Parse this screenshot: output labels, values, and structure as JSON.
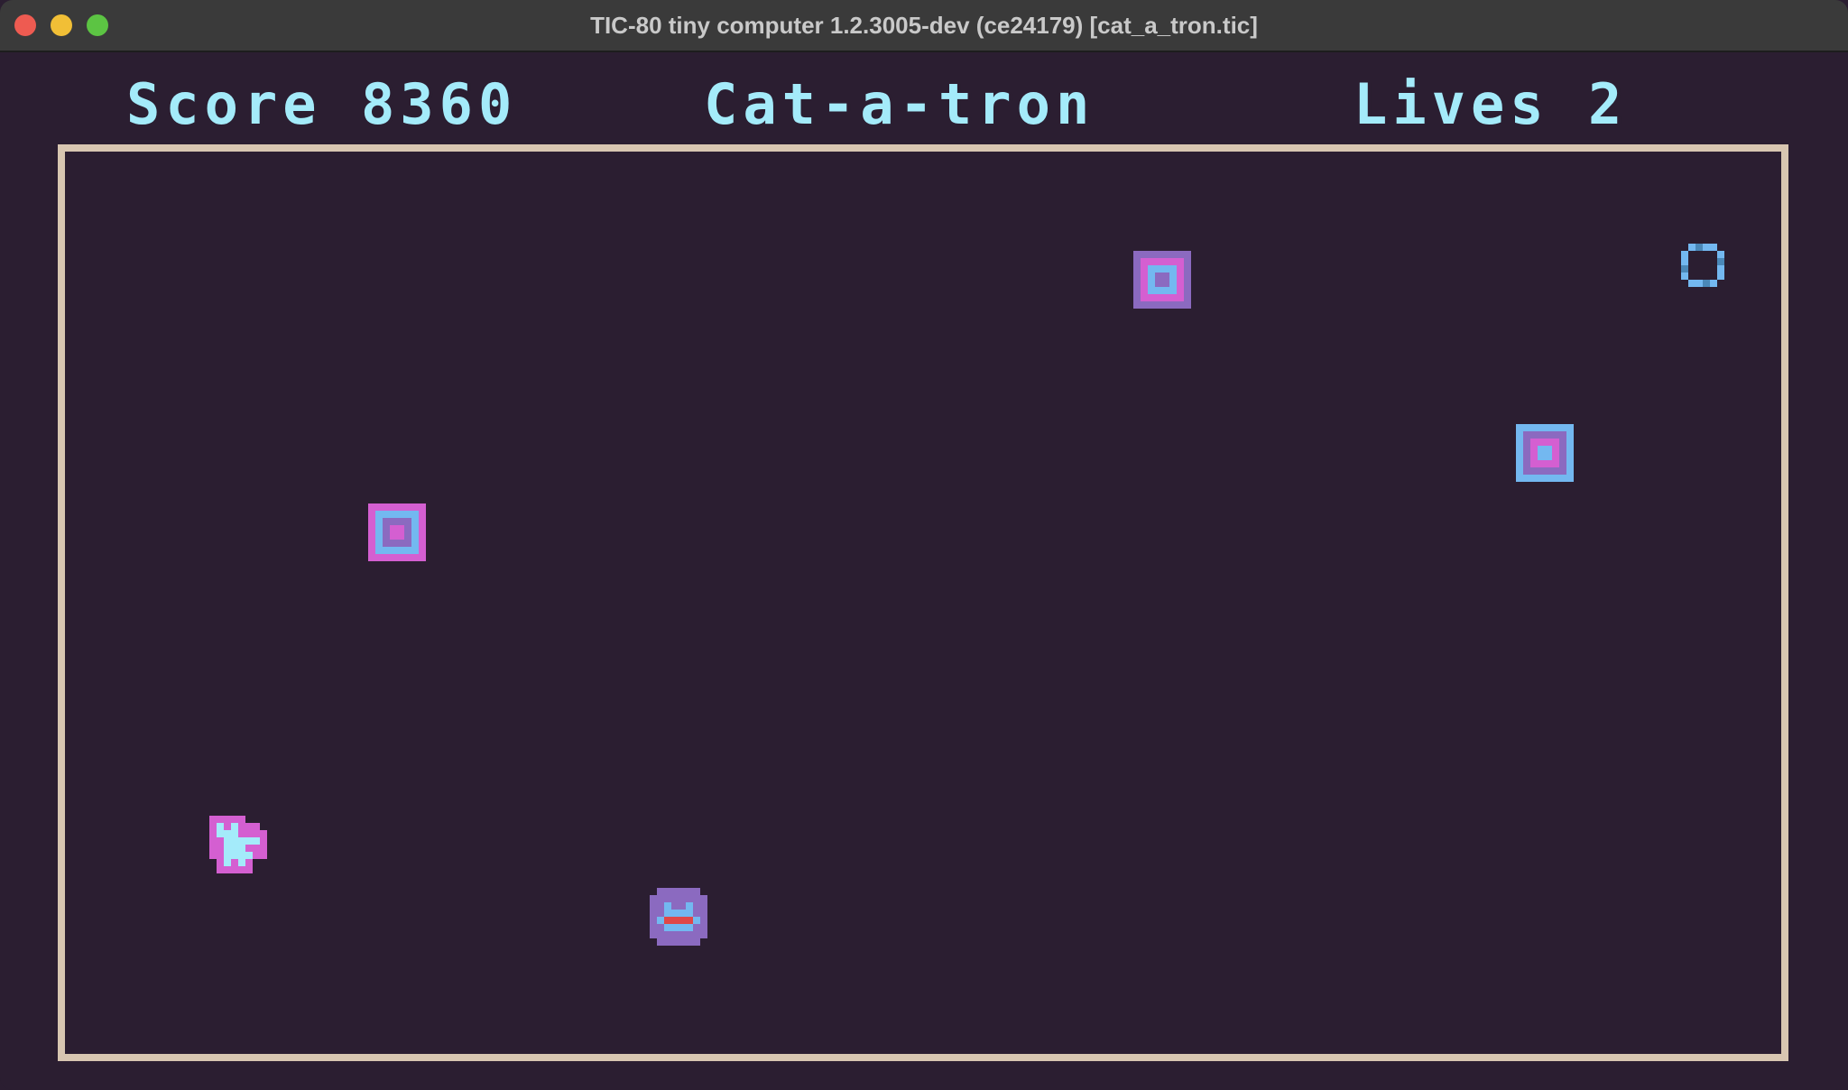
{
  "window": {
    "title": "TIC-80 tiny computer 1.2.3005-dev (ce24179) [cat_a_tron.tic]"
  },
  "hud": {
    "score_text": "Score 8360",
    "game_title": "Cat-a-tron",
    "lives_text": "Lives 2"
  },
  "sprites": {
    "player": "cat-icon",
    "enemy": "robot-face-icon",
    "pickup": "ring-icon",
    "obstacle": "square-box-icon"
  },
  "colors": {
    "background": "#2b1e31",
    "hud_text": "#a4ebfa",
    "arena_border": "#d8c6b1",
    "pink": "#d45fd1",
    "blue": "#73b8f0",
    "purple": "#8b6ac0"
  }
}
